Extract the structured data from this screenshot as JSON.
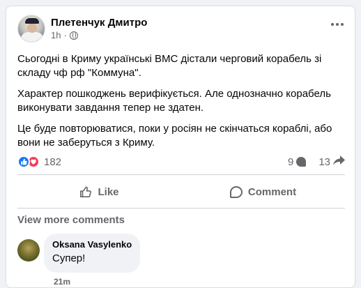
{
  "post": {
    "author": "Плетенчук Дмитро",
    "time": "1h",
    "time_separator": "·",
    "paragraphs": [
      "Сьогодні в Криму українські ВМС дістали черговий корабель зі складу чф рф  \"Коммуна\".",
      "Характер пошкоджень верифікується. Але однозначно корабель виконувати завдання тепер не здатен.",
      "Це буде повторюватися, поки у росіян не скінчаться кораблі, або вони не заберуться з Криму."
    ]
  },
  "stats": {
    "reactions_count": "182",
    "comments_count": "9",
    "shares_count": "13",
    "reaction_icons": [
      "like-icon",
      "love-icon"
    ]
  },
  "actions": {
    "like_label": "Like",
    "comment_label": "Comment"
  },
  "comments": {
    "view_more_label": "View more comments",
    "items": [
      {
        "author": "Oksana Vasylenko",
        "text": "Супер!",
        "time": "21m"
      }
    ]
  },
  "colors": {
    "accent": "#1877f2",
    "love": "#f33e58",
    "secondary_text": "#65676b",
    "background": "#f0f2f5"
  }
}
